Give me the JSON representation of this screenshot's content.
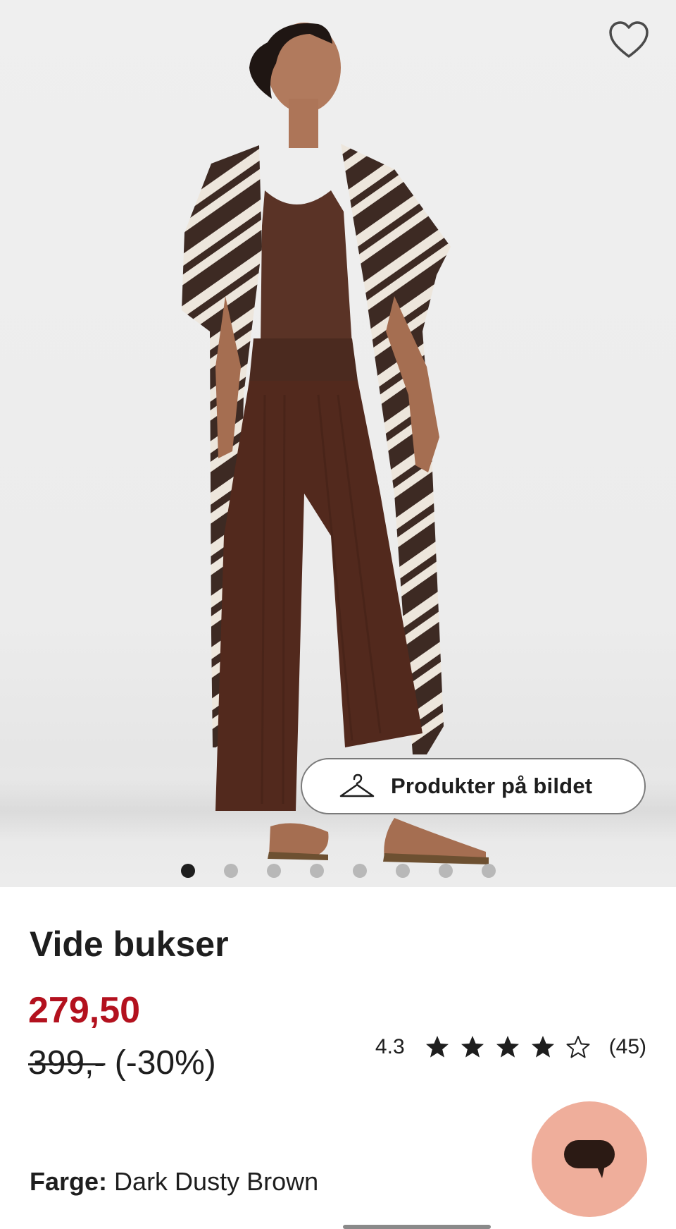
{
  "gallery": {
    "products_in_image_label": "Produkter på bildet",
    "slide_count": 8,
    "active_slide": 1,
    "icons": {
      "favorite": "heart-outline-icon",
      "products": "hanger-icon"
    }
  },
  "product": {
    "title": "Vide bukser",
    "price": "279,50",
    "old_price": "399,-",
    "discount": "(-30%)",
    "rating_value": "4.3",
    "rating_stars": 4.3,
    "review_count": "(45)",
    "color_label": "Farge:",
    "color_value": "Dark Dusty Brown"
  },
  "colors": {
    "sale_price": "#b3111e",
    "chat_button": "#efae9b",
    "text": "#1e1e1e"
  },
  "chat": {
    "icon": "chat-bubble-icon"
  }
}
